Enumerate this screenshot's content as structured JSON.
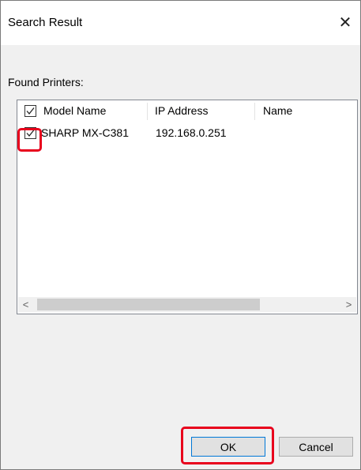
{
  "window": {
    "title": "Search Result",
    "close_glyph": "✕"
  },
  "found_printers_label": "Found Printers:",
  "list": {
    "columns": [
      {
        "label": "Model Name",
        "checked": true
      },
      {
        "label": "IP Address"
      },
      {
        "label": "Name"
      }
    ],
    "rows": [
      {
        "model": "SHARP MX-C381",
        "ip": "192.168.0.251",
        "name": "",
        "checked": true
      }
    ],
    "scroll_left_glyph": "<",
    "scroll_right_glyph": ">"
  },
  "buttons": {
    "ok": "OK",
    "cancel": "Cancel"
  },
  "colors": {
    "highlight": "#e8001c",
    "dialog_bg": "#f0f0f0",
    "button_bg": "#e1e1e1",
    "default_button_border": "#0078d7"
  },
  "icons": [
    "close-icon",
    "checkbox-check-icon",
    "scroll-left-icon",
    "scroll-right-icon"
  ]
}
